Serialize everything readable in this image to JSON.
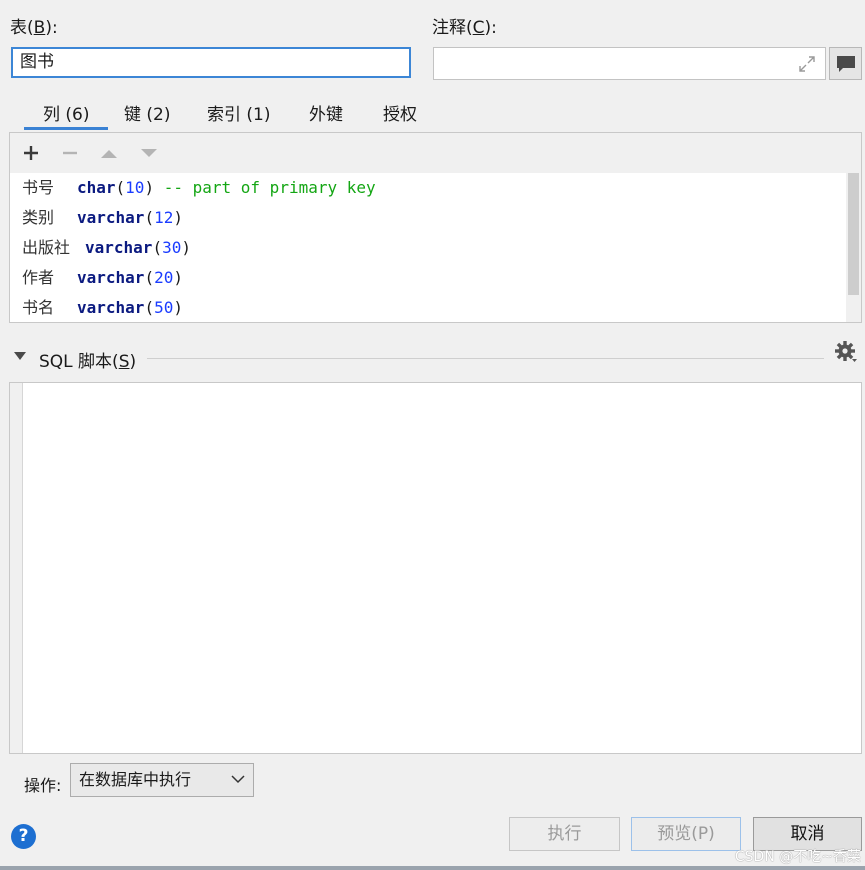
{
  "labels": {
    "table": "表(",
    "table_key": "B",
    "table_end": "):",
    "comment": "注释(",
    "comment_key": "C",
    "comment_end": "):"
  },
  "table_name": {
    "value": "图书"
  },
  "comment": {
    "value": ""
  },
  "tabs": [
    {
      "label": "列 (6)"
    },
    {
      "label": "键 (2)"
    },
    {
      "label": "索引 (1)"
    },
    {
      "label": "外键"
    },
    {
      "label": "授权"
    }
  ],
  "columns": [
    {
      "name": "书号",
      "type": "char",
      "open": "(",
      "size": "10",
      "close": ")",
      "comment": "-- part of primary key"
    },
    {
      "name": "类别",
      "type": "varchar",
      "open": "(",
      "size": "12",
      "close": ")",
      "comment": ""
    },
    {
      "name": "出版社",
      "type": "varchar",
      "open": "(",
      "size": "30",
      "close": ")",
      "comment": ""
    },
    {
      "name": "作者",
      "type": "varchar",
      "open": "(",
      "size": "20",
      "close": ")",
      "comment": ""
    },
    {
      "name": "书名",
      "type": "varchar",
      "open": "(",
      "size": "50",
      "close": ")",
      "comment": ""
    }
  ],
  "sql": {
    "label": "SQL 脚本(",
    "label_key": "S",
    "label_end": ")",
    "content": ""
  },
  "operation": {
    "label": "操作:",
    "selected": "在数据库中执行"
  },
  "buttons": {
    "execute": "执行",
    "preview": "预览(P)",
    "cancel": "取消",
    "help": "?"
  },
  "watermark": "CSDN @不吃~香菜",
  "icons": {
    "add": "plus-icon",
    "remove": "minus-icon",
    "up": "arrow-up-icon",
    "down": "arrow-down-icon",
    "expand": "expand-icon",
    "comment": "speech-bubble-icon",
    "collapse": "triangle-down-icon",
    "settings": "gear-icon",
    "dropdown": "chevron-down-icon",
    "help": "question-icon"
  },
  "colors": {
    "accent": "#3c86d6",
    "keyword": "#0b1a80",
    "number": "#1a3cff",
    "comment": "#14a614",
    "help": "#1d6fd1"
  }
}
